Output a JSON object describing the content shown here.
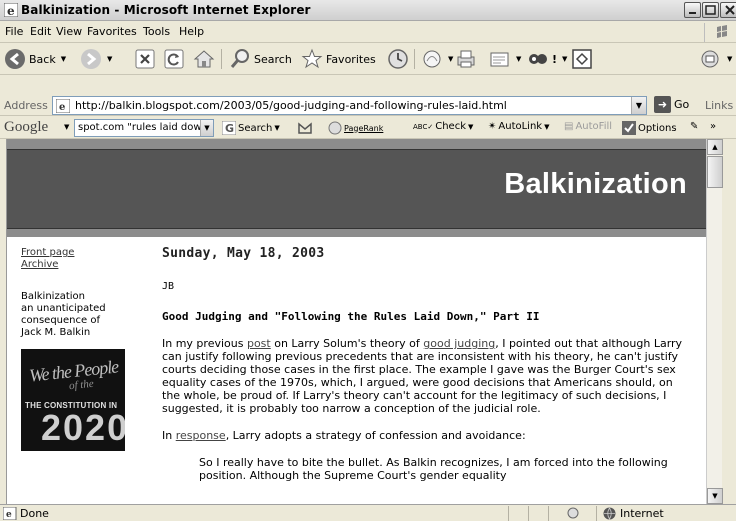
{
  "window": {
    "title": "Balkinization - Microsoft Internet Explorer"
  },
  "menu": [
    "File",
    "Edit",
    "View",
    "Favorites",
    "Tools",
    "Help"
  ],
  "toolbar": {
    "back": "Back",
    "search": "Search",
    "favorites": "Favorites"
  },
  "address": {
    "label": "Address",
    "url": "http://balkin.blogspot.com/2003/05/good-judging-and-following-rules-laid.html",
    "go": "Go",
    "links": "Links"
  },
  "google": {
    "logo": "Google",
    "query": "spot.com \"rules laid down\"",
    "search": "Search",
    "pagerank": "PageRank",
    "check": "Check",
    "autolink": "AutoLink",
    "autofill": "AutoFill",
    "options": "Options"
  },
  "blog": {
    "name": "Balkinization",
    "sidebar": {
      "front_page": "Front page",
      "archive": "Archive",
      "blurb_1": "Balkinization",
      "blurb_2": "an unanticipated",
      "blurb_3": "consequence of",
      "blurb_4": "Jack M. Balkin"
    },
    "book": {
      "script": "We the People",
      "script2": "of the",
      "constitution": "THE CONSTITUTION IN",
      "year": "2020"
    }
  },
  "post": {
    "date": "Sunday, May 18, 2003",
    "author": "JB",
    "title": "Good Judging and \"Following the Rules Laid Down,\" Part II",
    "p1_a": "In my previous ",
    "p1_link1": "post",
    "p1_b": " on Larry Solum's theory of ",
    "p1_link2": "good judging",
    "p1_c": ", I pointed out that although Larry can justify following previous precedents that are inconsistent with his theory, he can't justify courts deciding those cases in the first place. The example I gave was the Burger Court's sex equality cases of the 1970s, which, I argued, were good decisions that Americans should, on the whole, be proud of. If Larry's theory can't account for the legitimacy of such decisions, I suggested, it is probably too narrow a conception of the judicial role.",
    "p2_a": "In ",
    "p2_link": "response",
    "p2_b": ", Larry adopts a strategy of confession and avoidance:",
    "quote": "So I really have to bite the bullet. As Balkin recognizes, I am forced into the following position. Although the Supreme Court's gender equality"
  },
  "status": {
    "text": "Done",
    "zone": "Internet"
  }
}
